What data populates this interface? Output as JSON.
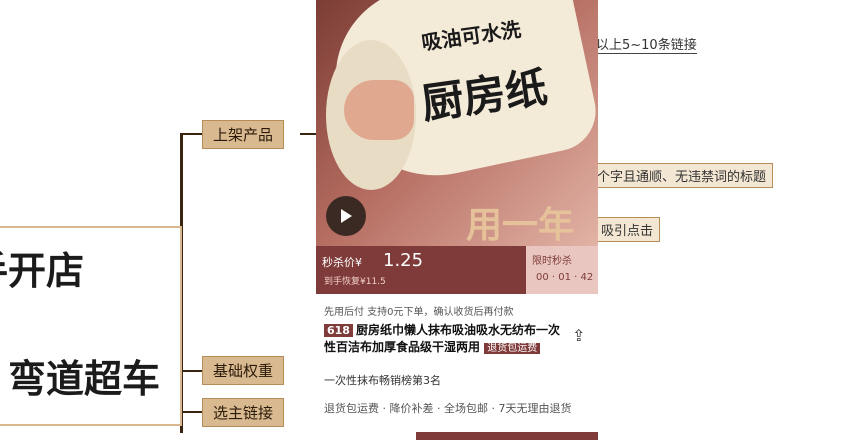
{
  "mindmap": {
    "center_line1": "手开店",
    "center_line2": "弯道超车",
    "branches": [
      {
        "label": "上架产品"
      },
      {
        "label": "基础权重"
      },
      {
        "label": "选主链接"
      }
    ],
    "leaves": [
      {
        "text": "以上5~10条链接"
      },
      {
        "text": "个字且通顺、无违禁词的标题"
      },
      {
        "text": "吸引点击"
      }
    ]
  },
  "product": {
    "promo_small": "吸油可水洗",
    "promo_big": "厨房纸",
    "promo_year": "用一年",
    "price_label": "秒杀价¥",
    "price_value": "1.25",
    "price_original": "到手恢复¥11.5",
    "flash_label": "限时秒杀",
    "flash_time": "00 · 01 · 42",
    "notice": "先用后付  支持0元下单，确认收货后再付款",
    "tag_618": "618",
    "title": "厨房纸巾懒人抹布吸油吸水无纺布一次性百洁布加厚食品级干湿两用",
    "shipping_tag": "退货包运费",
    "rank": "一次性抹布畅销榜第3名",
    "services": "退货包运费 · 降价补差 · 全场包邮 · 7天无理由退货"
  }
}
